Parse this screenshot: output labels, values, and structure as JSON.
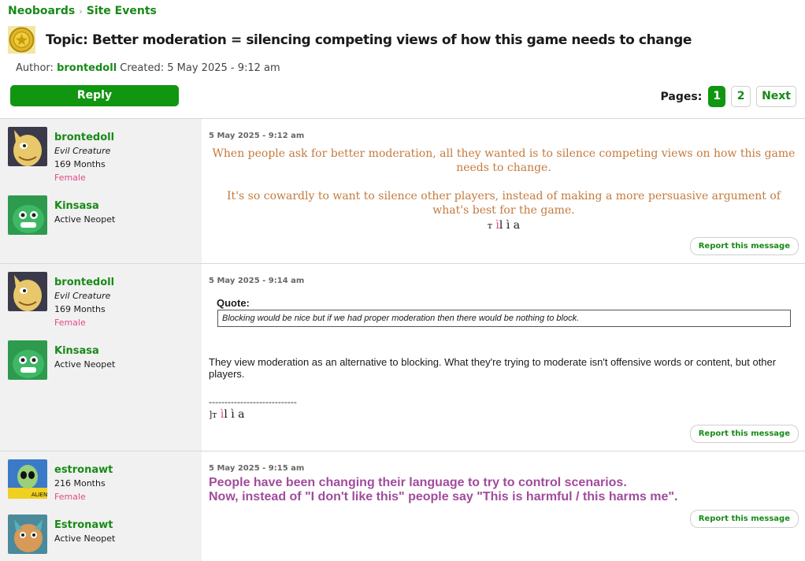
{
  "breadcrumb": {
    "root": "Neoboards",
    "separator": "›",
    "current": "Site Events"
  },
  "topic": {
    "icon": "gold-coin-icon",
    "title": "Topic: Better moderation = silencing competing views of how this game needs to change",
    "author_label": "Author:",
    "author": "brontedoll",
    "created_label": "Created:",
    "created": "5 May 2025 - 9:12 am"
  },
  "reply_label": "Reply",
  "pagination": {
    "label": "Pages:",
    "pages": [
      "1",
      "2"
    ],
    "current": "1",
    "next_label": "Next"
  },
  "report_label": "Report this message",
  "posts": [
    {
      "date": "5 May 2025 - 9:12 am",
      "user": {
        "name": "brontedoll",
        "title": "Evil Creature",
        "age": "169 Months",
        "gender": "Female"
      },
      "pet": {
        "name": "Kinsasa",
        "status": "Active Neopet"
      },
      "paragraphs": [
        "When people ask for better moderation, all they wanted is to silence competing views on how this game needs to change.",
        "It's so cowardly to want to silence other players, instead of making a more persuasive argument of what's best for the game."
      ],
      "signature": {
        "prefix": "т",
        "pink": "ì",
        "rest": "l ì a"
      }
    },
    {
      "date": "5 May 2025 - 9:14 am",
      "user": {
        "name": "brontedoll",
        "title": "Evil Creature",
        "age": "169 Months",
        "gender": "Female"
      },
      "pet": {
        "name": "Kinsasa",
        "status": "Active Neopet"
      },
      "quote_label": "Quote:",
      "quote": "Blocking would be nice but if we had proper moderation then there would be nothing to block.",
      "text": "They view moderation as an alternative to blocking. What they're trying to moderate isn't offensive words or content, but other players.",
      "divider": "----------------------------",
      "signature": {
        "prefix": "]т",
        "pink": "ì",
        "rest": "l ì a"
      }
    },
    {
      "date": "5 May 2025 - 9:15 am",
      "user": {
        "name": "estronawt",
        "age": "216 Months",
        "gender": "Female"
      },
      "pet": {
        "name": "Estronawt",
        "status": "Active Neopet"
      },
      "lines": [
        "People have been changing their language to try to control scenarios.",
        "Now, instead of \"I don't like this\" people say \"This is harmful / this harms me\"."
      ]
    }
  ]
}
